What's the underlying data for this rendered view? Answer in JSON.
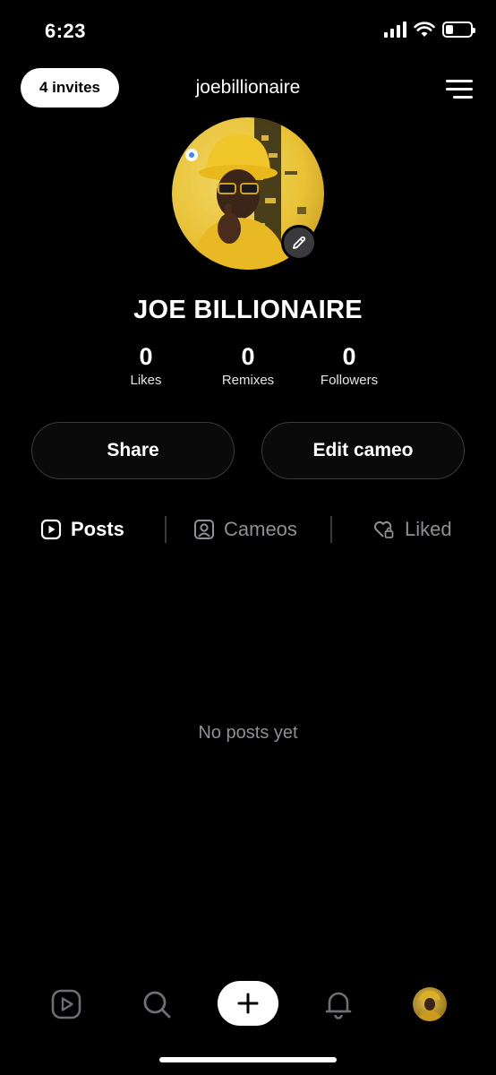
{
  "status_bar": {
    "time": "6:23",
    "icons": [
      "cellular-signal-icon",
      "wifi-icon",
      "battery-icon"
    ],
    "battery_level": 0.3
  },
  "header": {
    "invites_label": "4 invites",
    "username": "joebillionaire",
    "menu_icon": "menu-icon"
  },
  "profile": {
    "display_name": "JOE BILLIONAIRE",
    "edit_icon": "pencil-icon",
    "stats": [
      {
        "value": "0",
        "label": "Likes"
      },
      {
        "value": "0",
        "label": "Remixes"
      },
      {
        "value": "0",
        "label": "Followers"
      }
    ]
  },
  "actions": {
    "share_label": "Share",
    "edit_cameo_label": "Edit cameo"
  },
  "tabs": [
    {
      "label": "Posts",
      "icon": "play-square-icon",
      "active": true
    },
    {
      "label": "Cameos",
      "icon": "person-square-icon",
      "active": false
    },
    {
      "label": "Liked",
      "icon": "heart-lock-icon",
      "active": false
    }
  ],
  "content": {
    "empty_message": "No posts yet"
  },
  "bottom_nav": {
    "items": [
      "feed-play-icon",
      "search-icon",
      "plus-icon",
      "bell-icon",
      "profile-avatar"
    ]
  },
  "colors": {
    "background": "#000000",
    "muted_text": "#8e8e93",
    "border": "#3a3a3c",
    "avatar_yellow": "#e9c237"
  }
}
